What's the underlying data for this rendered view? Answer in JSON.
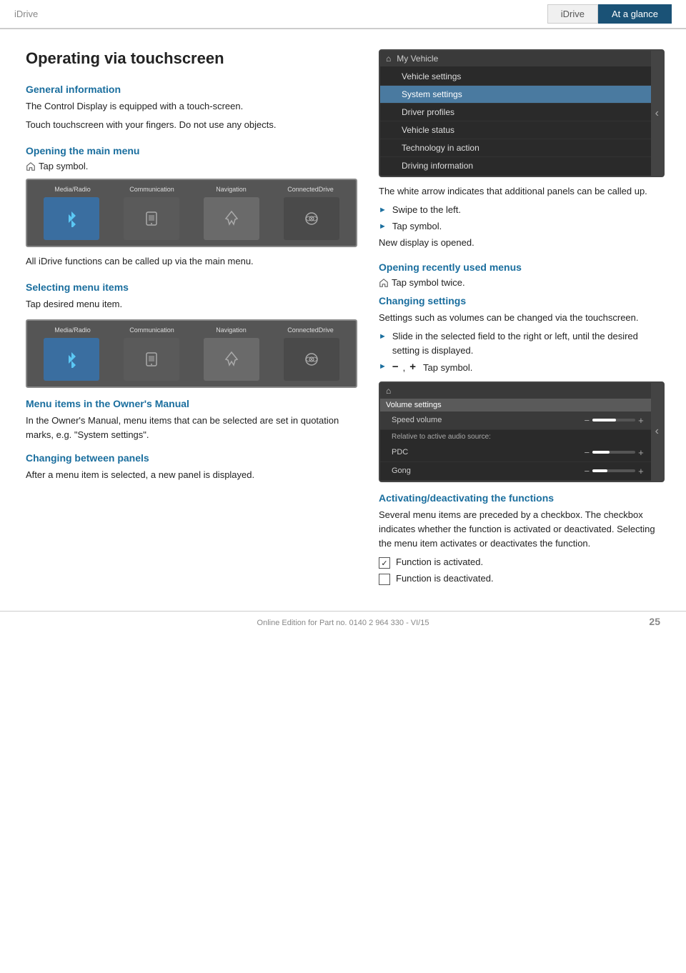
{
  "header": {
    "brand": "iDrive",
    "tab_inactive": "iDrive",
    "tab_active": "At a glance"
  },
  "page_title": "Operating via touchscreen",
  "sections": {
    "general_info": {
      "heading": "General information",
      "para1": "The Control Display is equipped with a touch-screen.",
      "para2": "Touch touchscreen with your fingers. Do not use any objects."
    },
    "opening_main_menu": {
      "heading": "Opening the main menu",
      "tap_label": "Tap symbol.",
      "after_text": "All iDrive functions can be called up via the main menu."
    },
    "selecting_menu_items": {
      "heading": "Selecting menu items",
      "tap_label": "Tap desired menu item."
    },
    "menu_items_owners": {
      "heading": "Menu items in the Owner's Manual",
      "text": "In the Owner's Manual, menu items that can be selected are set in quotation marks, e.g. \"System settings\"."
    },
    "changing_between_panels": {
      "heading": "Changing between panels",
      "text": "After a menu item is selected, a new panel is displayed."
    }
  },
  "right_sections": {
    "white_arrow": {
      "text": "The white arrow indicates that additional panels can be called up.",
      "bullet1": "Swipe to the left.",
      "bullet2": "Tap symbol."
    },
    "new_display_opened": "New display is opened.",
    "opening_recently_used": {
      "heading": "Opening recently used menus",
      "tap_label": "Tap symbol twice."
    },
    "changing_settings": {
      "heading": "Changing settings",
      "text": "Settings such as volumes can be changed via the touchscreen.",
      "bullet1": "Slide in the selected field to the right or left, until the desired setting is displayed.",
      "bullet2_prefix": "–  ,  +",
      "bullet2_suffix": "Tap symbol."
    },
    "activating_deactivating": {
      "heading": "Activating/deactivating the functions",
      "text": "Several menu items are preceded by a checkbox. The checkbox indicates whether the function is activated or deactivated. Selecting the menu item activates or deactivates the function.",
      "checkbox_checked": "Function is activated.",
      "checkbox_unchecked": "Function is deactivated."
    }
  },
  "screen1": {
    "home_icon": "⌂",
    "title": "My Vehicle",
    "items": [
      {
        "label": "Vehicle settings",
        "active": false
      },
      {
        "label": "System settings",
        "active": true
      },
      {
        "label": "Driver profiles",
        "active": false
      },
      {
        "label": "Vehicle status",
        "active": false
      },
      {
        "label": "Technology in action",
        "active": false
      },
      {
        "label": "Driving information",
        "active": false
      }
    ]
  },
  "menu_grid": {
    "col_labels": [
      "Media/Radio",
      "Communication",
      "Navigation",
      "ConnectedDrive"
    ]
  },
  "vol_screen": {
    "home_icon": "⌂",
    "title": "Volume settings",
    "speed_volume_label": "Speed volume",
    "relative_label": "Relative to active audio source:",
    "pdc_label": "PDC",
    "gong_label": "Gong",
    "speed_fill": "55%",
    "pdc_fill": "40%",
    "gong_fill": "35%"
  },
  "footer": {
    "text": "Online Edition for Part no. 0140 2 964 330 - VI/15",
    "page_number": "25"
  }
}
